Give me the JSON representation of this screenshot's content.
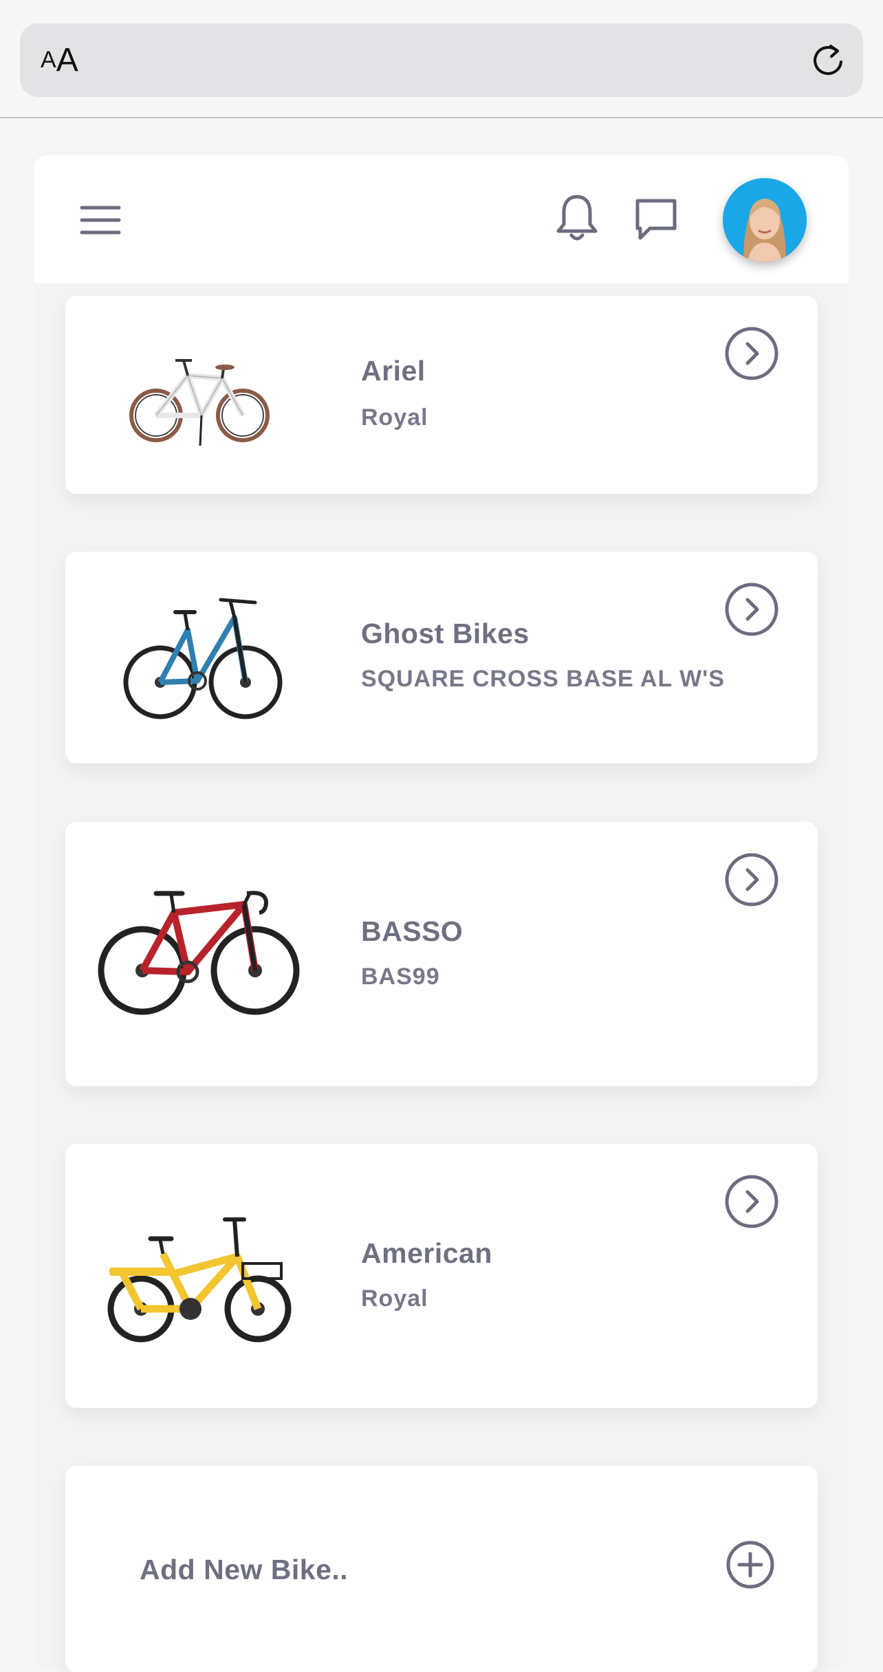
{
  "browser": {
    "text_size_small": "A",
    "text_size_large": "A"
  },
  "header": {
    "menu_icon": "hamburger-menu-icon",
    "notification_icon": "bell-icon",
    "messages_icon": "chat-bubble-icon",
    "avatar_bg": "#1aa7e8"
  },
  "bikes": [
    {
      "name": "Ariel",
      "model": "Royal",
      "color": "#e8e8ea",
      "accent": "#8a5b48"
    },
    {
      "name": "Ghost Bikes",
      "model": "SQUARE CROSS BASE AL W'S",
      "color": "#2f7fb0",
      "accent": "#222222"
    },
    {
      "name": "BASSO",
      "model": "BAS99",
      "color": "#b8232b",
      "accent": "#222222"
    },
    {
      "name": "American",
      "model": "Royal",
      "color": "#f2c531",
      "accent": "#222222"
    }
  ],
  "add_bike": {
    "label": "Add New Bike.."
  }
}
